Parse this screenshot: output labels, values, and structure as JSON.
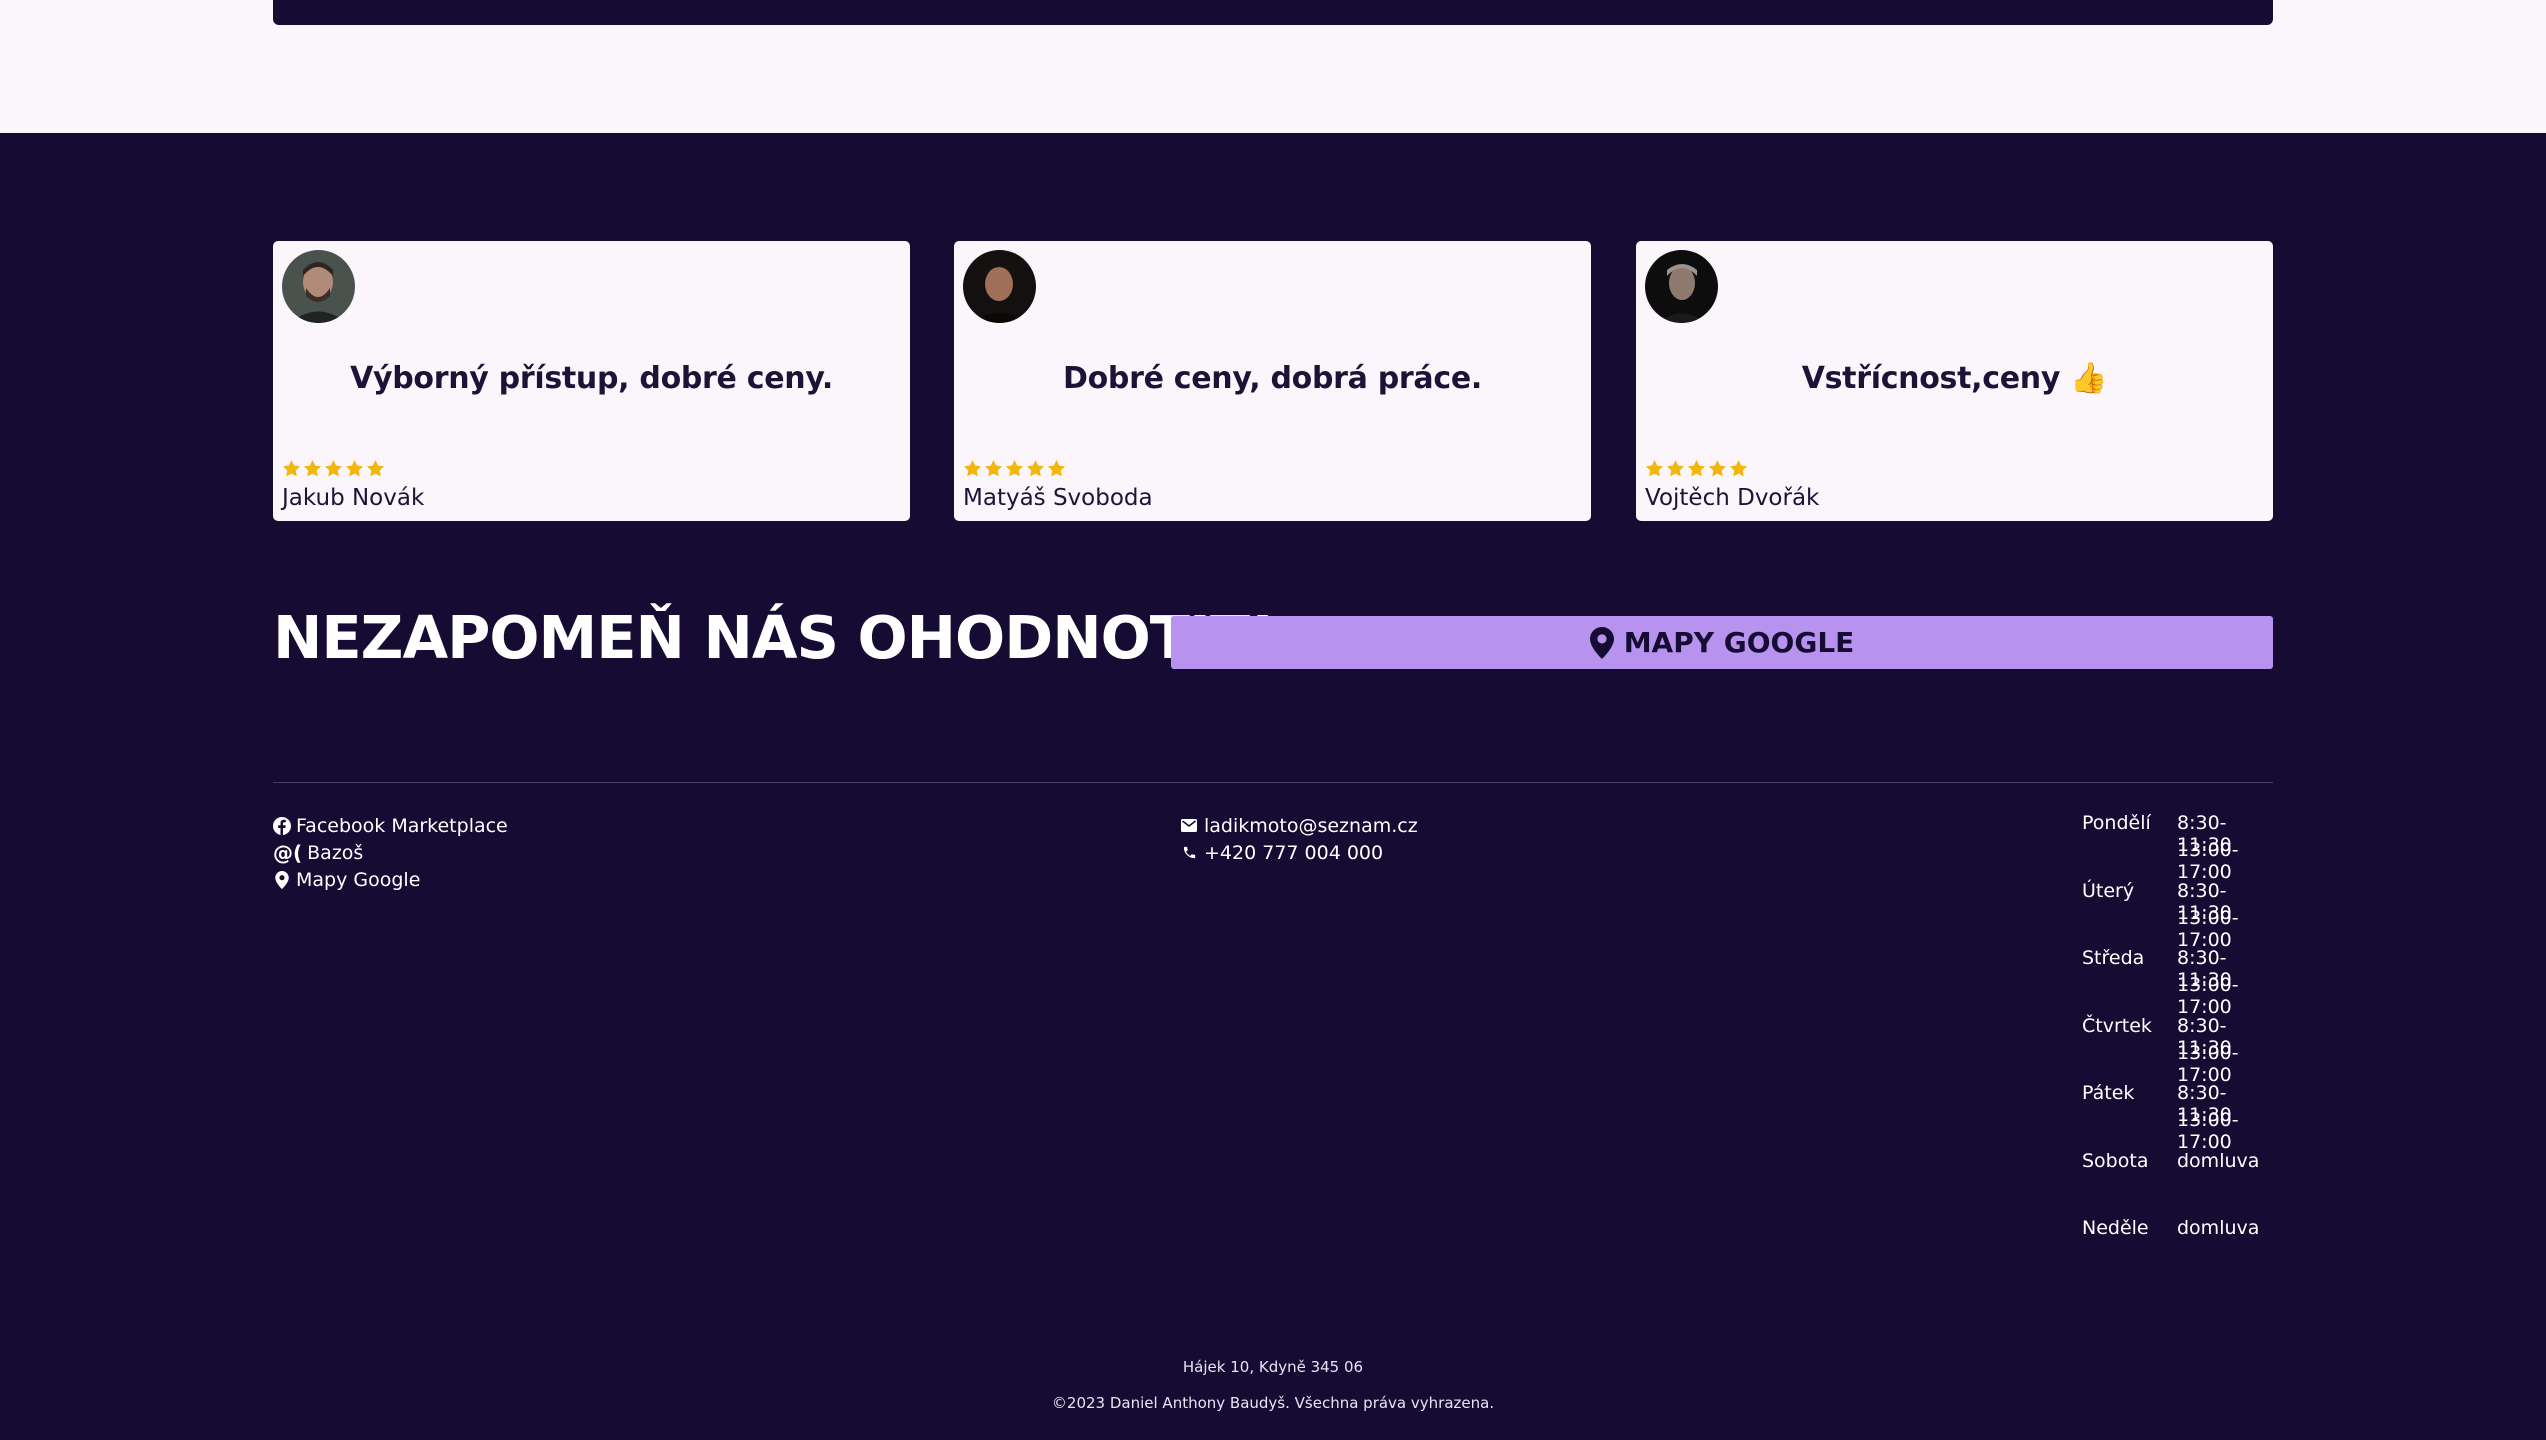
{
  "reviews": [
    {
      "text": "Výborný přístup, dobré ceny.",
      "name": "Jakub Novák",
      "rating": 5
    },
    {
      "text": "Dobré ceny, dobrá práce.",
      "name": "Matyáš Svoboda",
      "rating": 5
    },
    {
      "text": "Vstřícnost,ceny 👍",
      "name": "Vojtěch Dvořák",
      "rating": 5
    }
  ],
  "cta": {
    "heading": "NEZAPOMEŇ NÁS OHODNOTIT!",
    "maps_button_label": "MAPY GOOGLE"
  },
  "footer": {
    "links": [
      {
        "icon": "facebook-icon",
        "label": "Facebook Marketplace"
      },
      {
        "icon": "bazos-icon",
        "label": "Bazoš",
        "icon_text": "@("
      },
      {
        "icon": "map-pin-icon",
        "label": "Mapy Google"
      }
    ],
    "contact": {
      "email": "ladikmoto@seznam.cz",
      "phone": "+420 777 004 000"
    },
    "hours": [
      {
        "day": "Pondělí",
        "morning": "8:30-11:30",
        "afternoon": "13:00-17:00"
      },
      {
        "day": "Úterý",
        "morning": "8:30-11:30",
        "afternoon": "13:00-17:00"
      },
      {
        "day": "Středa",
        "morning": "8:30-11:30",
        "afternoon": "13:00-17:00"
      },
      {
        "day": "Čtvrtek",
        "morning": "8:30-11:30",
        "afternoon": "13:00-17:00"
      },
      {
        "day": "Pátek",
        "morning": "8:30-11:30",
        "afternoon": "13:00-17:00"
      },
      {
        "day": "Sobota",
        "morning": "domluva",
        "afternoon": ""
      },
      {
        "day": "Neděle",
        "morning": "domluva",
        "afternoon": ""
      }
    ],
    "address": "Hájek 10, Kdyně 345 06",
    "copyright": "©2023 Daniel Anthony Baudyš. Všechna práva vyhrazena."
  },
  "colors": {
    "background": "#150b33",
    "light_background": "#fbf6fc",
    "accent": "#b793ef",
    "star": "#f2b70f",
    "text_dark": "#1c1436"
  }
}
